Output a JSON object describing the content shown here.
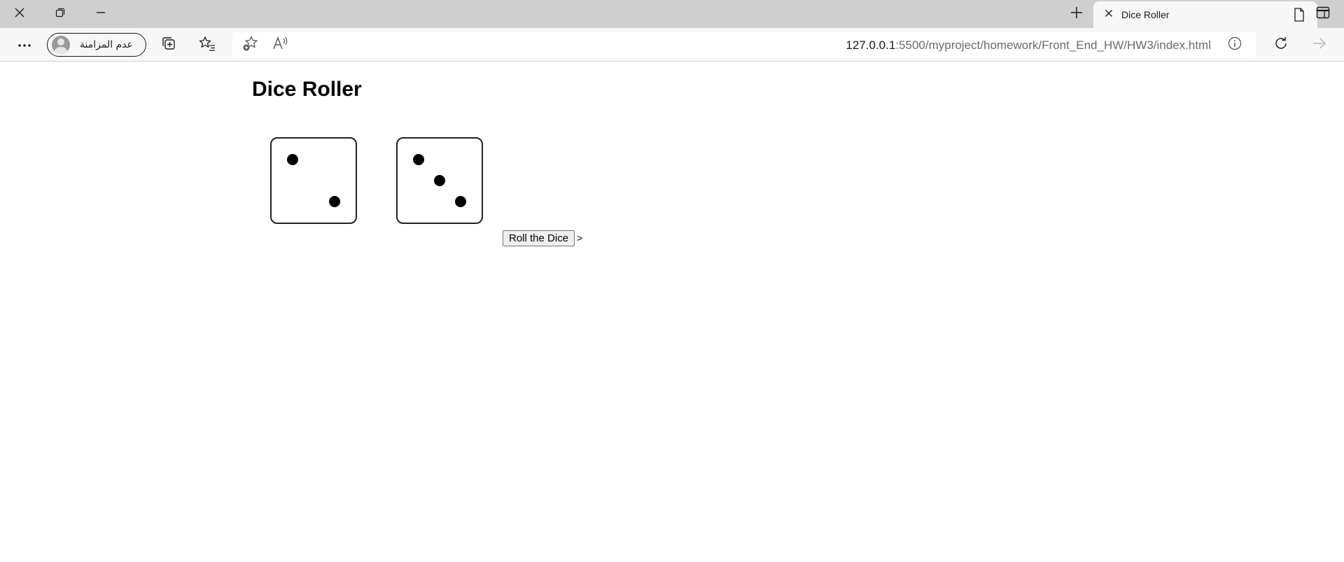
{
  "browser": {
    "tab": {
      "title": "Dice Roller"
    },
    "profile": {
      "label": "عدم المزامنة"
    },
    "address": {
      "host": "127.0.0.1",
      "path": ":5500/myproject/homework/Front_End_HW/HW3/index.html"
    }
  },
  "page": {
    "title": "Dice Roller",
    "dice": [
      {
        "value": 2
      },
      {
        "value": 3
      }
    ],
    "roll_button_label": "Roll the Dice",
    "trailing_text": ">"
  }
}
